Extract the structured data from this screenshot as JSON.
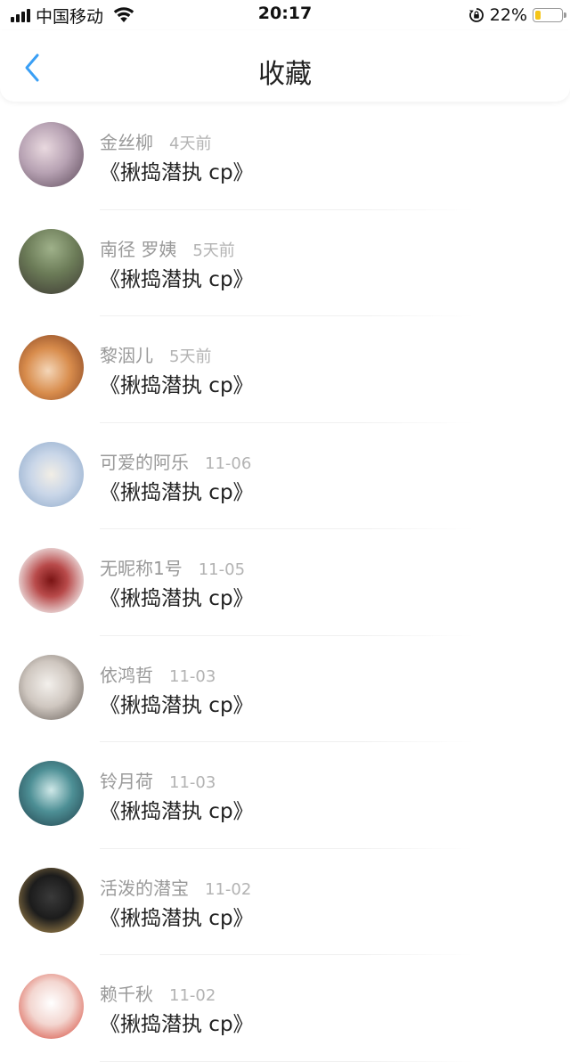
{
  "status_bar": {
    "carrier": "中国移动",
    "time": "20:17",
    "battery_pct": "22%",
    "battery_level": 0.22,
    "icons": [
      "signal-icon",
      "wifi-icon",
      "orientation-lock-icon",
      "battery-icon"
    ]
  },
  "header": {
    "title": "收藏",
    "back_icon": "chevron-left-icon"
  },
  "colors": {
    "accent": "#3a9ff5",
    "text_primary": "#222222",
    "text_secondary": "#999999",
    "battery_fill": "#f5c518"
  },
  "items": [
    {
      "name": "金丝柳",
      "time": "4天前",
      "title": "《揪捣潜执 cp》"
    },
    {
      "name": "南径 罗姨",
      "time": "5天前",
      "title": "《揪捣潜执 cp》"
    },
    {
      "name": "黎洇儿",
      "time": "5天前",
      "title": "《揪捣潜执 cp》"
    },
    {
      "name": "可爱的阿乐",
      "time": "11-06",
      "title": "《揪捣潜执 cp》"
    },
    {
      "name": "无昵称1号",
      "time": "11-05",
      "title": "《揪捣潜执 cp》"
    },
    {
      "name": "依鸿哲",
      "time": "11-03",
      "title": "《揪捣潜执 cp》"
    },
    {
      "name": "铃月荷",
      "time": "11-03",
      "title": "《揪捣潜执 cp》"
    },
    {
      "name": "活泼的潜宝",
      "time": "11-02",
      "title": "《揪捣潜执 cp》"
    },
    {
      "name": "赖千秋",
      "time": "11-02",
      "title": "《揪捣潜执 cp》"
    }
  ]
}
